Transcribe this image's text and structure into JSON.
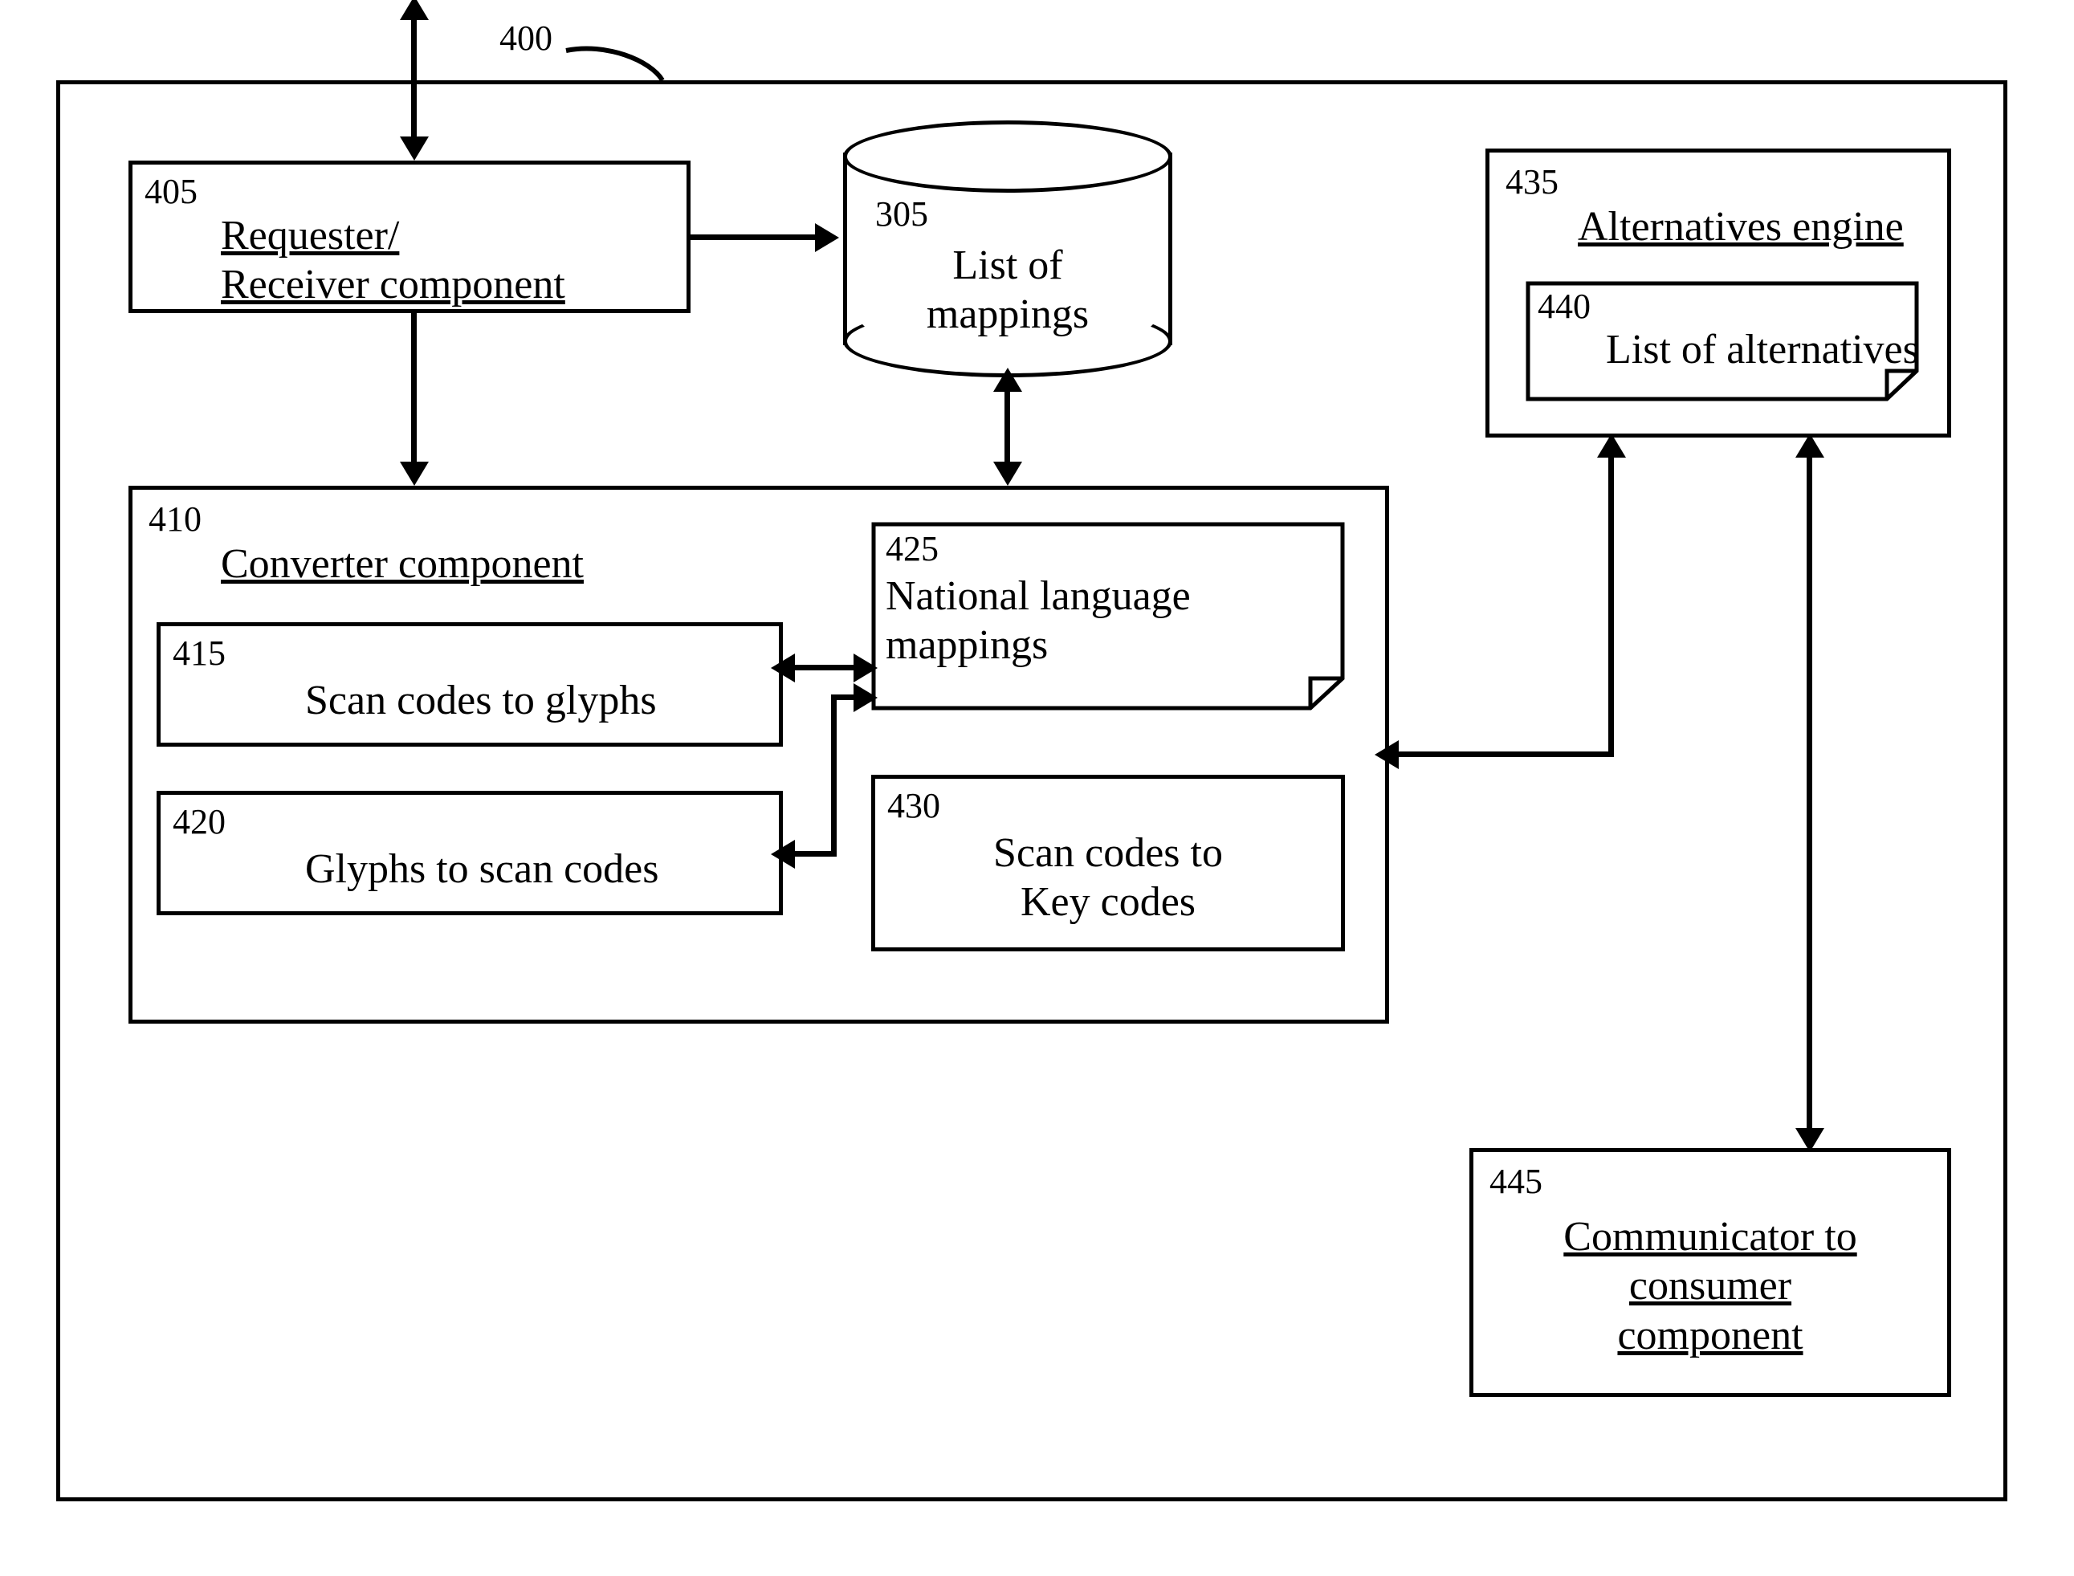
{
  "figure_ref": "400",
  "outer": {},
  "boxes": {
    "requester": {
      "ref": "405",
      "title": "Requester/\nReceiver component"
    },
    "mappings_db": {
      "ref": "305",
      "title": "List of\nmappings"
    },
    "converter": {
      "ref": "410",
      "title": "Converter component",
      "children": {
        "scan_to_glyphs": {
          "ref": "415",
          "title": "Scan codes to glyphs"
        },
        "glyphs_to_scan": {
          "ref": "420",
          "title": "Glyphs to scan codes"
        },
        "nl_mappings": {
          "ref": "425",
          "title": "National language\nmappings"
        },
        "scan_to_key": {
          "ref": "430",
          "title": "Scan codes to\nKey codes"
        }
      }
    },
    "alternatives": {
      "ref": "435",
      "title": "Alternatives engine",
      "children": {
        "list_alt": {
          "ref": "440",
          "title": "List of alternatives"
        }
      }
    },
    "communicator": {
      "ref": "445",
      "title": "Communicator to\nconsumer\ncomponent"
    }
  }
}
